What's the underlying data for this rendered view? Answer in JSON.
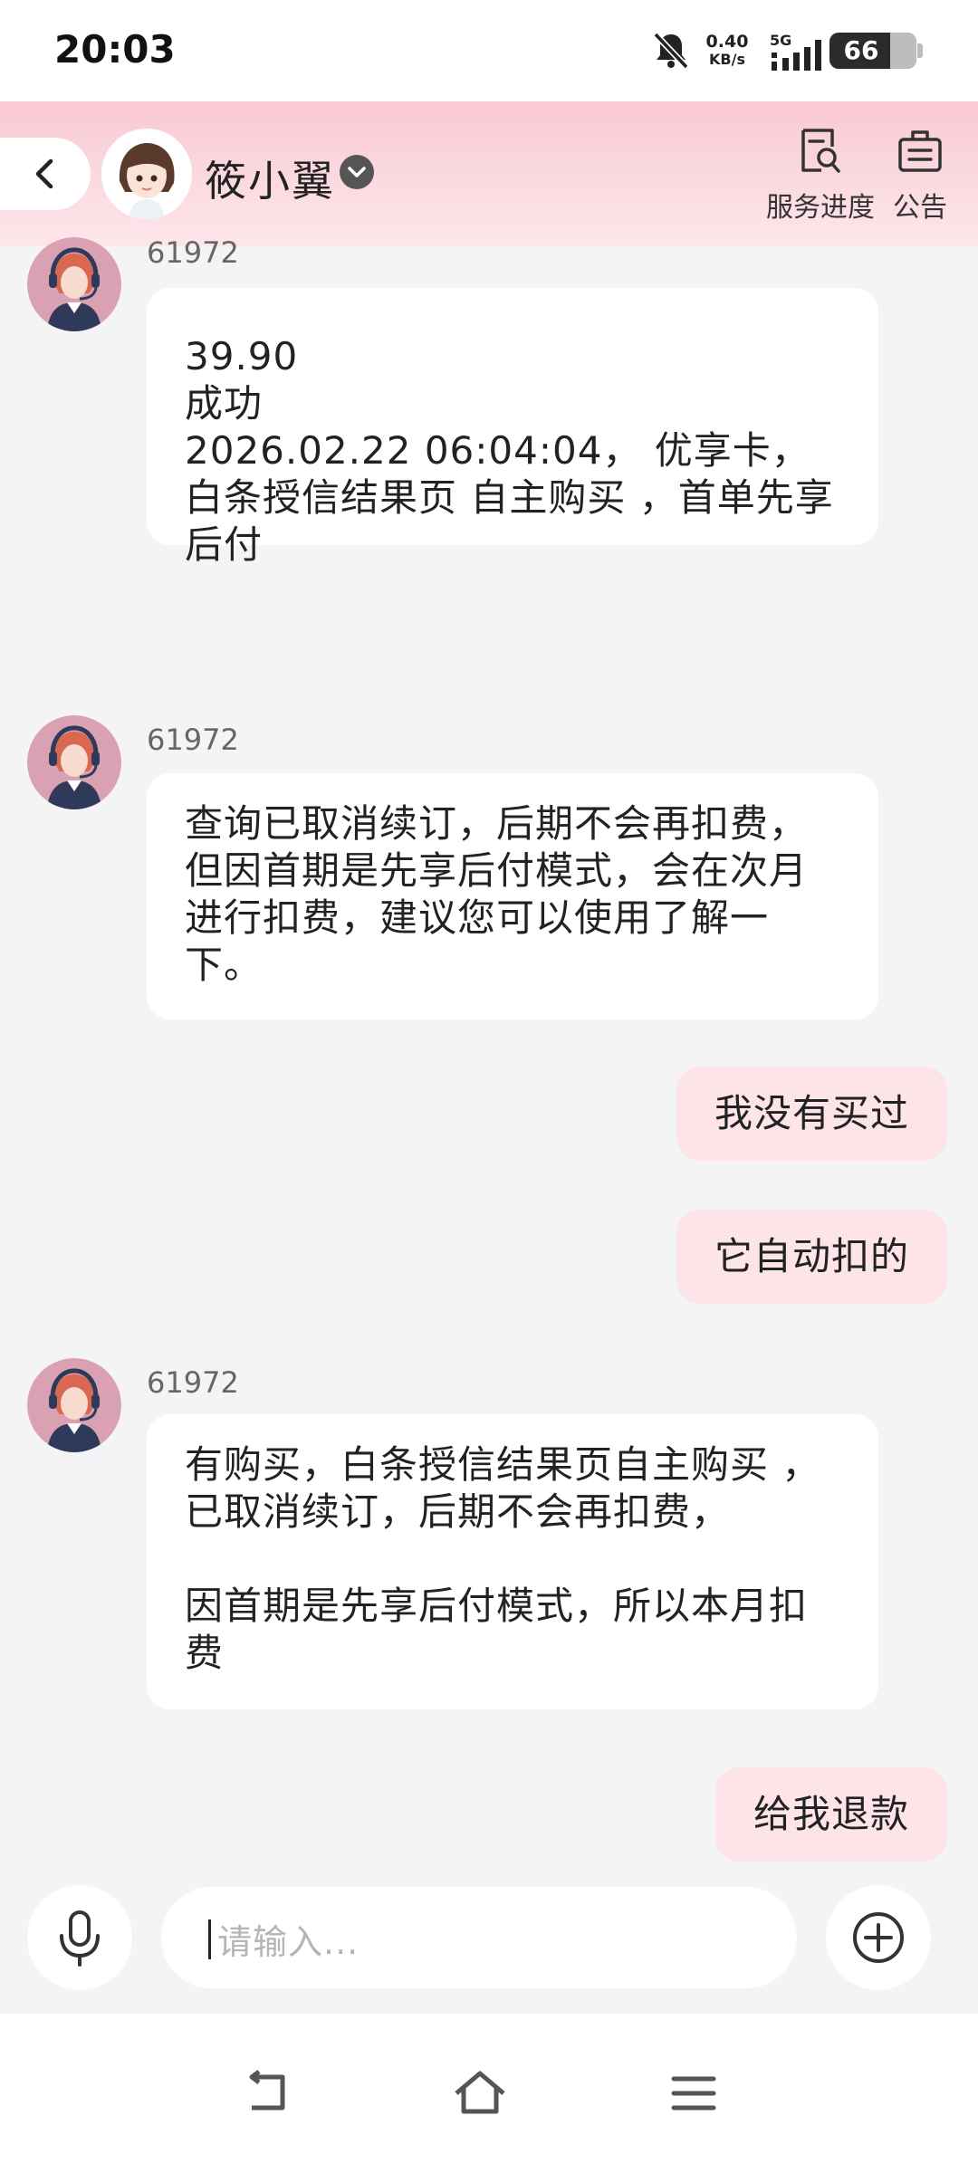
{
  "status_bar": {
    "time": "20:03",
    "net_speed_value": "0.40",
    "net_speed_unit": "KB/s",
    "network": "5G",
    "battery_level": "66",
    "battery_fraction": 0.66,
    "icons": [
      "bell-muted-icon",
      "signal-icon",
      "battery-icon"
    ]
  },
  "header": {
    "name": "筱小翼",
    "actions": [
      {
        "label": "服务进度",
        "icon": "service-progress-icon"
      },
      {
        "label": "公告",
        "icon": "announcement-icon"
      }
    ],
    "colors": {
      "gradient_top": "#f9c9d3",
      "gradient_bottom": "#fde6eb"
    }
  },
  "messages": [
    {
      "sender": "agent",
      "id": "61972",
      "text": "39.90\n成功\n2026.02.22 06:04:04， 优享卡， 白条授信结果页 自主购买 ，首单先享后付"
    },
    {
      "sender": "agent",
      "id": "61972",
      "text": "查询已取消续订，后期不会再扣费，但因首期是先享后付模式，会在次月进行扣费，建议您可以使用了解一下。"
    },
    {
      "sender": "user",
      "text": "我没有买过"
    },
    {
      "sender": "user",
      "text": "它自动扣的"
    },
    {
      "sender": "agent",
      "id": "61972",
      "text": "有购买，白条授信结果页自主购买 ，已取消续订，后期不会再扣费，\n\n因首期是先享后付模式，所以本月扣费"
    },
    {
      "sender": "user",
      "text": "给我退款"
    }
  ],
  "input": {
    "placeholder": "请输入...",
    "value": ""
  },
  "colors": {
    "user_bubble": "#fde4e8",
    "agent_bubble": "#ffffff",
    "background": "#f4f4f6"
  }
}
